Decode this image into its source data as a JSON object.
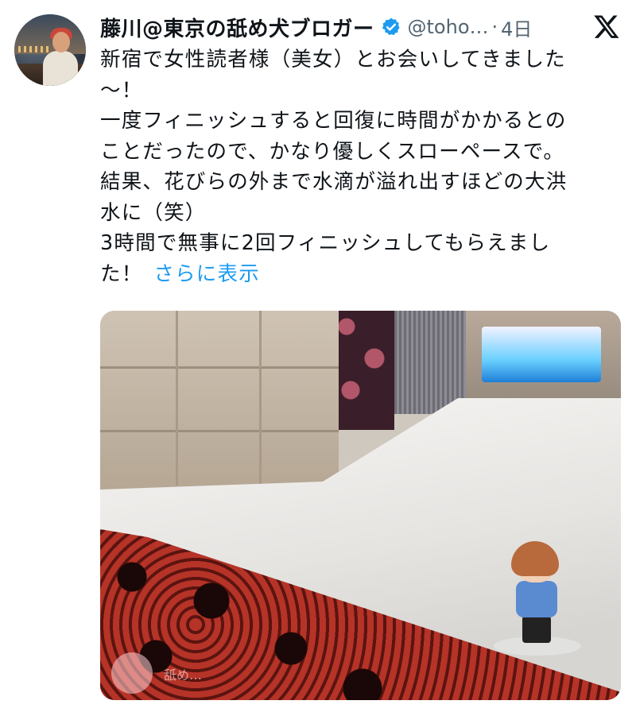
{
  "post": {
    "author_name": "藤川@東京の舐め犬ブロガー",
    "handle": "@toho…",
    "separator": "·",
    "time": "4日",
    "lines": [
      "新宿で女性読者様（美女）とお会いしてきました",
      "〜！",
      "一度フィニッシュすると回復に時間がかかるとの",
      "ことだったので、かなり優しくスローペースで。",
      "結果、花びらの外まで水滴が溢れ出すほどの大洪",
      "水に（笑）",
      "3時間で無事に2回フィニッシュしてもらえまし",
      "た！"
    ],
    "show_more": "さらに表示"
  },
  "icons": {
    "verified": "verified-badge-icon",
    "platform": "x-logo-icon"
  },
  "watermark": {
    "text": "舐め…"
  },
  "colors": {
    "link": "#1d9bf0",
    "muted": "#536471",
    "text": "#0f1419"
  }
}
